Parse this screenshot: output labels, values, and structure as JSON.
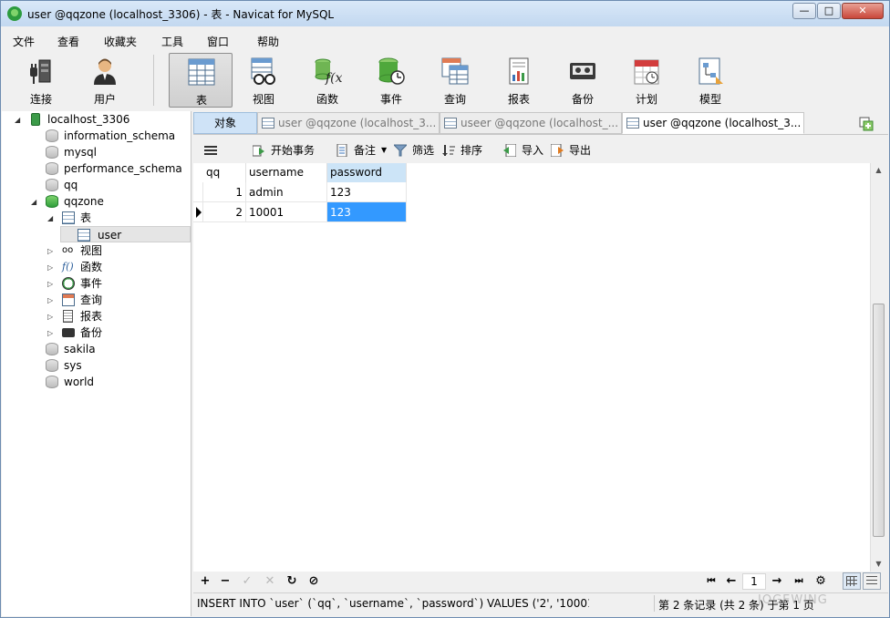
{
  "window": {
    "title": "user @qqzone (localhost_3306) - 表 - Navicat for MySQL",
    "min": "—",
    "max": "□",
    "close": "✕"
  },
  "menu": [
    "文件",
    "查看",
    "收藏夹",
    "工具",
    "窗口",
    "帮助"
  ],
  "toolbar": [
    {
      "label": "连接",
      "icon": "connection-icon"
    },
    {
      "label": "用户",
      "icon": "user-icon"
    },
    {
      "label": "表",
      "icon": "table-icon"
    },
    {
      "label": "视图",
      "icon": "view-icon"
    },
    {
      "label": "函数",
      "icon": "function-icon"
    },
    {
      "label": "事件",
      "icon": "event-icon"
    },
    {
      "label": "查询",
      "icon": "query-icon"
    },
    {
      "label": "报表",
      "icon": "report-icon"
    },
    {
      "label": "备份",
      "icon": "backup-icon"
    },
    {
      "label": "计划",
      "icon": "schedule-icon"
    },
    {
      "label": "模型",
      "icon": "model-icon"
    }
  ],
  "tree": {
    "server": "localhost_3306",
    "databases_top": [
      "information_schema",
      "mysql",
      "performance_schema",
      "qq"
    ],
    "open_db": "qqzone",
    "tables_folder": "表",
    "selected_table": "user",
    "subfolders": [
      "视图",
      "函数",
      "事件",
      "查询",
      "报表",
      "备份"
    ],
    "databases_bottom": [
      "sakila",
      "sys",
      "world"
    ],
    "expand": "◢",
    "collapse": "▷"
  },
  "tabs": {
    "objects": "对象",
    "items": [
      "user @qqzone (localhost_3...",
      "useer @qqzone (localhost_...",
      "user @qqzone (localhost_3..."
    ]
  },
  "subtoolbar": {
    "begin_tx": "开始事务",
    "memo": "备注",
    "filter": "筛选",
    "sort": "排序",
    "import": "导入",
    "export": "导出"
  },
  "grid": {
    "columns": [
      "qq",
      "username",
      "password"
    ],
    "rows": [
      [
        "1",
        "admin",
        "123"
      ],
      [
        "2",
        "10001",
        "123"
      ]
    ]
  },
  "bottom": {
    "add": "+",
    "delete": "−",
    "apply": "✓",
    "discard": "✕",
    "refresh": "↻",
    "stop": "⊘",
    "page": "1",
    "first": "⏮",
    "prev": "←",
    "next": "→",
    "last": "⏭",
    "settings": "⚙"
  },
  "status": {
    "sql": "INSERT INTO `user` (`qq`, `username`, `password`) VALUES ('2', '10001', '1",
    "records": "第 2 条记录 (共 2 条) 于第 1 页"
  },
  "watermark": "JOGEWING",
  "colors": {
    "selection": "#3399ff",
    "tab_objects": "#cfe3f7",
    "header_selected": "#cce4f7"
  }
}
